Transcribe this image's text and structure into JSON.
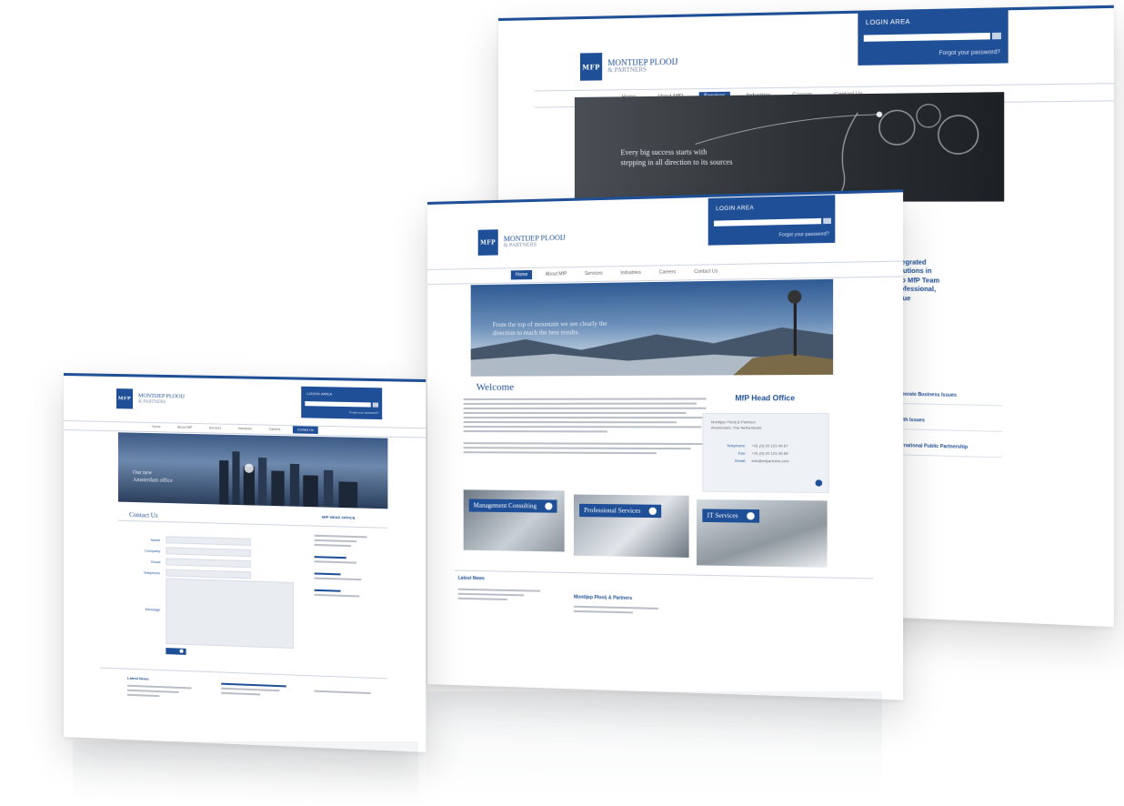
{
  "brand": {
    "logo_mark": "MFP",
    "name_line1": "MONTIJEP PLOOIJ",
    "name_line2": "& PARTNERS"
  },
  "login": {
    "title": "LOGIN AREA",
    "forgot": "Forgot your password?"
  },
  "back_page": {
    "nav": [
      "Home",
      "About MfP",
      "Services",
      "Industries",
      "Careers",
      "Contact Us"
    ],
    "active_index": 2,
    "banner_caption_line1": "Every big success starts with",
    "banner_caption_line2": "stepping in all direction to its sources",
    "side_heading_words": [
      "Integrated",
      "solutions in",
      "d to MfP Team",
      "professional,",
      "value"
    ],
    "side_links": [
      "Corporate Business Issues",
      "Health Issues",
      "International Public Partnership"
    ]
  },
  "middle_page": {
    "nav": [
      "Home",
      "About MfP",
      "Services",
      "Industries",
      "Careers",
      "Contact Us"
    ],
    "active_index": 0,
    "banner_caption_line1": "From the top of mountain we see clearly the",
    "banner_caption_line2": "direction to reach the best results.",
    "welcome_heading": "Welcome",
    "office_heading": "MfP Head Office",
    "office_address_line1": "Montijep Plooij & Partners",
    "office_address_line2": "Amsterdam, The Netherlands",
    "office_labels": [
      "Telephone:",
      "Fax:",
      "Email:"
    ],
    "office_values": [
      "+31 (0) 20 123 45 67",
      "+31 (0) 20 123 45 68",
      "info@mfpartners.com"
    ],
    "tiles": [
      "Management Consulting",
      "Professional Services",
      "IT Services"
    ],
    "footer_heading": "Latest News",
    "footer_contact_title": "Montijep Plooij & Partners"
  },
  "front_page": {
    "nav": [
      "Home",
      "About MfP",
      "Services",
      "Industries",
      "Careers",
      "Contact Us"
    ],
    "active_index": 5,
    "banner_caption_line1": "Our new",
    "banner_caption_line2": "Amsterdam office",
    "page_heading": "Contact Us",
    "side_heading": "MfP HEAD OFFICE",
    "form_labels": [
      "Name",
      "Company",
      "Email",
      "Telephone",
      "Message"
    ],
    "footer_heading": "Latest News"
  },
  "colors": {
    "brand_blue": "#1f4f96",
    "page_bg": "#ffffff"
  }
}
